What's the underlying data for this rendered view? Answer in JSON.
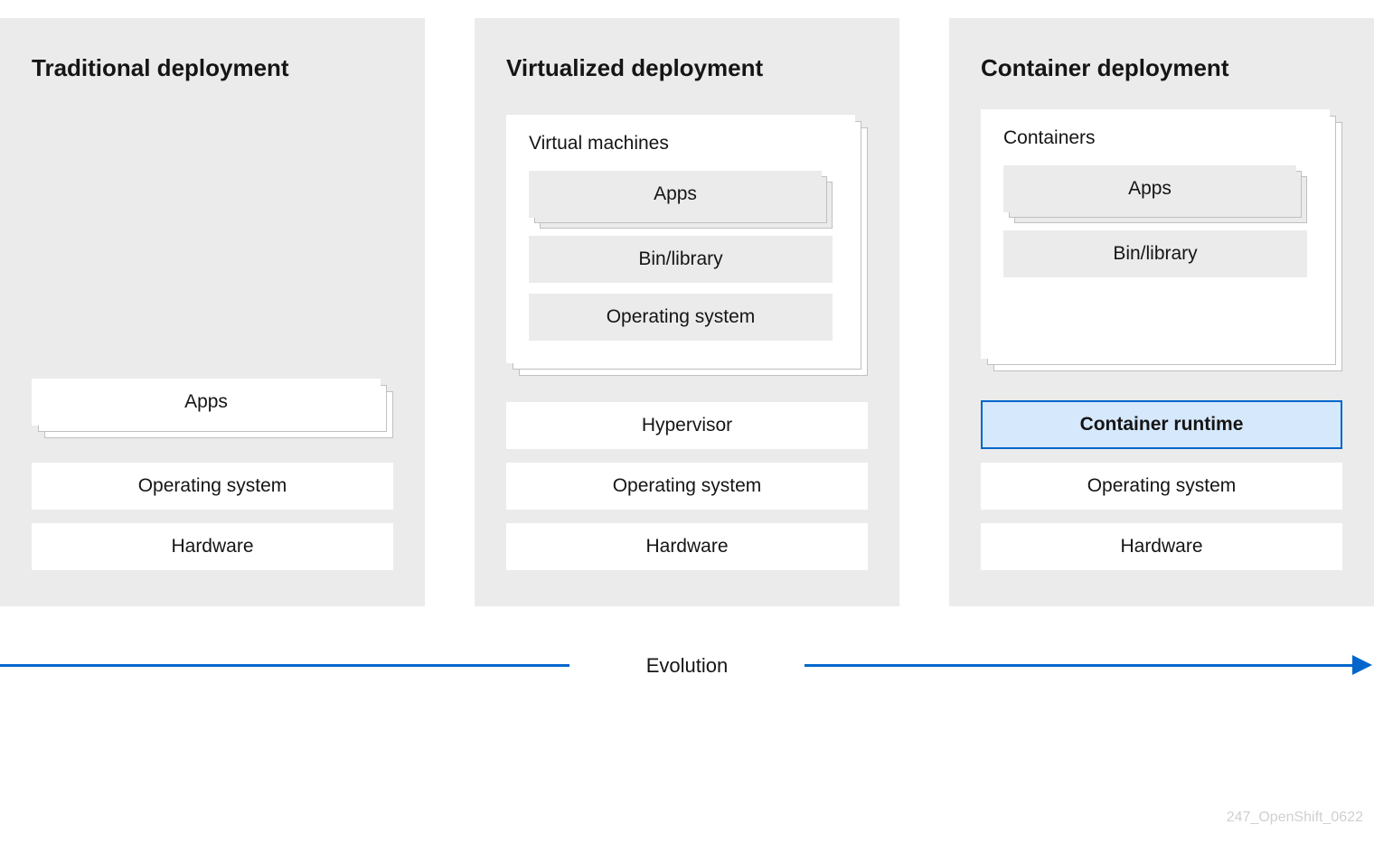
{
  "columns": [
    {
      "title": "Traditional deployment",
      "top_stack": null,
      "apps_stack": "Apps",
      "middle_box": null,
      "os": "Operating system",
      "hw": "Hardware"
    },
    {
      "title": "Virtualized deployment",
      "top_stack": {
        "title": "Virtual machines",
        "apps": "Apps",
        "lib": "Bin/library",
        "os": "Operating system"
      },
      "apps_stack": null,
      "middle_box": {
        "label": "Hypervisor",
        "highlight": false
      },
      "os": "Operating system",
      "hw": "Hardware"
    },
    {
      "title": "Container deployment",
      "top_stack": {
        "title": "Containers",
        "apps": "Apps",
        "lib": "Bin/library",
        "os": null
      },
      "apps_stack": null,
      "middle_box": {
        "label": "Container runtime",
        "highlight": true
      },
      "os": "Operating system",
      "hw": "Hardware"
    }
  ],
  "arrow_label": "Evolution",
  "watermark": "247_OpenShift_0622"
}
